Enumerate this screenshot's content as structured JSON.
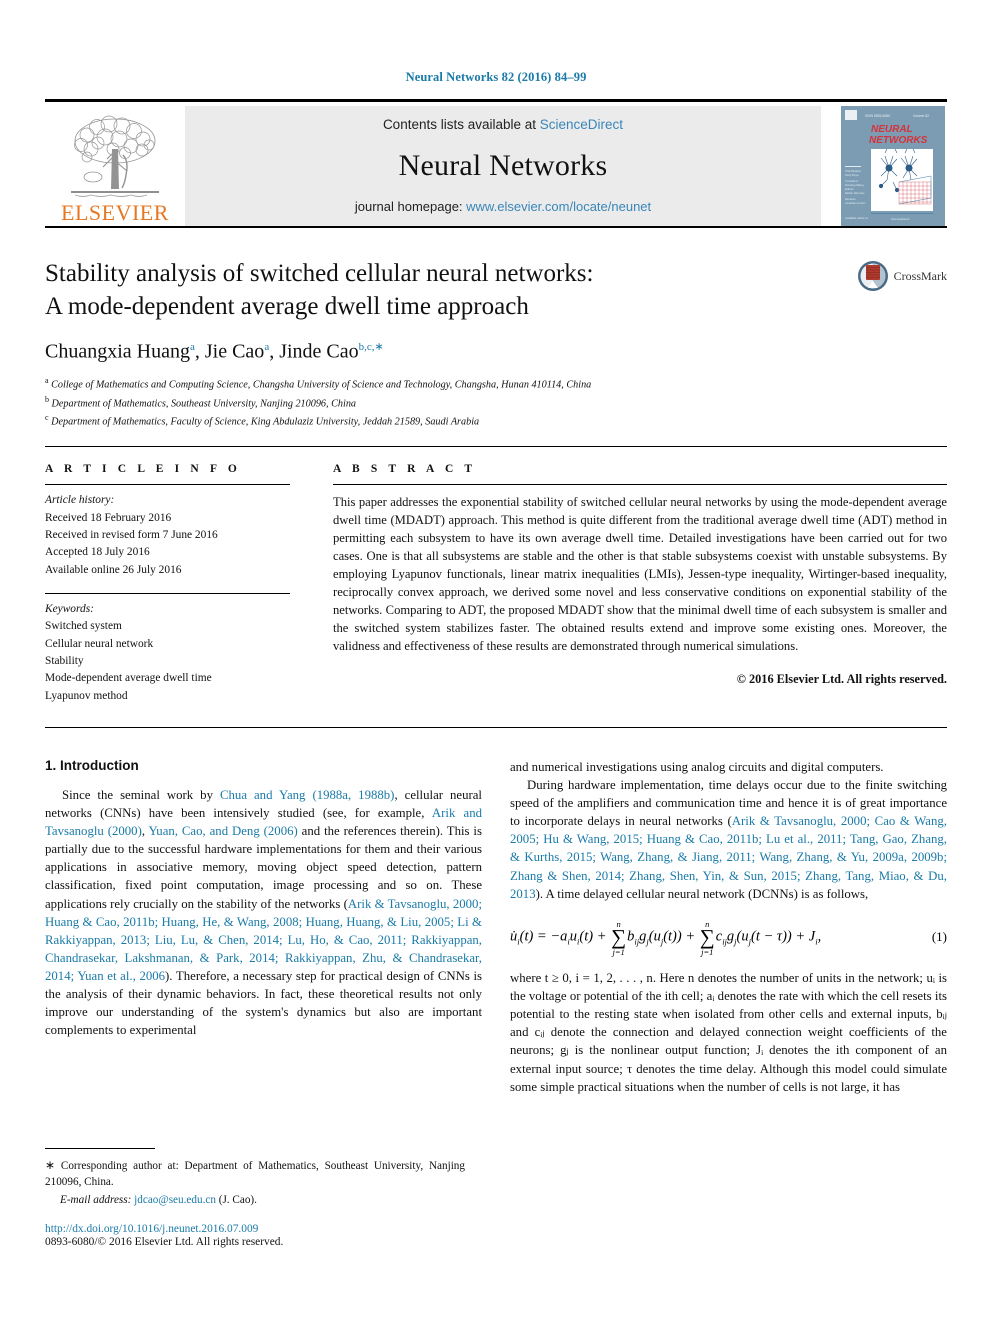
{
  "running_head": "Neural Networks 82 (2016) 84–99",
  "masthead": {
    "contents_prefix": "Contents lists available at ",
    "sciencedirect": "ScienceDirect",
    "journal_name": "Neural Networks",
    "homepage_prefix": "journal homepage: ",
    "homepage_url": "www.elsevier.com/locate/neunet",
    "publisher": "ELSEVIER",
    "cover_title_line1": "NEURAL",
    "cover_title_line2": "NETWORKS"
  },
  "colors": {
    "link_blue": "#1a7aa8",
    "sciencedirect_blue": "#3a86b8",
    "elsevier_orange": "#E87722",
    "masthead_grey": "#ebebeb",
    "cover_blue": "#6f93ad"
  },
  "article": {
    "title_line1": "Stability analysis of switched cellular neural networks:",
    "title_line2": "A mode-dependent average dwell time approach",
    "crossmark_label": "CrossMark",
    "authors": [
      {
        "name": "Chuangxia Huang",
        "sup": "a",
        "sep": ", "
      },
      {
        "name": "Jie Cao",
        "sup": "a",
        "sep": ", "
      },
      {
        "name": "Jinde Cao",
        "sup": "b,c,∗",
        "sep": ""
      }
    ],
    "affiliations": [
      {
        "mark": "a",
        "text": "College of Mathematics and Computing Science, Changsha University of Science and Technology, Changsha, Hunan 410114, China"
      },
      {
        "mark": "b",
        "text": "Department of Mathematics, Southeast University, Nanjing 210096, China"
      },
      {
        "mark": "c",
        "text": "Department of Mathematics, Faculty of Science, King Abdulaziz University, Jeddah 21589, Saudi Arabia"
      }
    ]
  },
  "article_info": {
    "heading": "A R T I C L E    I N F O",
    "history_label": "Article history:",
    "history": [
      "Received 18 February 2016",
      "Received in revised form 7 June 2016",
      "Accepted 18 July 2016",
      "Available online 26 July 2016"
    ],
    "keywords_label": "Keywords:",
    "keywords": [
      "Switched system",
      "Cellular neural network",
      "Stability",
      "Mode-dependent average dwell time",
      "Lyapunov method"
    ]
  },
  "abstract": {
    "heading": "A B S T R A C T",
    "text": "This paper addresses the exponential stability of switched cellular neural networks by using the mode-dependent average dwell time (MDADT) approach. This method is quite different from the traditional average dwell time (ADT) method in permitting each subsystem to have its own average dwell time. Detailed investigations have been carried out for two cases. One is that all subsystems are stable and the other is that stable subsystems coexist with unstable subsystems. By employing Lyapunov functionals, linear matrix inequalities (LMIs), Jessen-type inequality, Wirtinger-based inequality, reciprocally convex approach, we derived some novel and less conservative conditions on exponential stability of the networks. Comparing to ADT, the proposed MDADT show that the minimal dwell time of each subsystem is smaller and the switched system stabilizes faster. The obtained results extend and improve some existing ones. Moreover, the validness and effectiveness of these results are demonstrated through numerical simulations.",
    "copyright": "© 2016 Elsevier Ltd. All rights reserved."
  },
  "body": {
    "section_title": "1. Introduction",
    "left_p1_a": "Since the seminal work by ",
    "left_p1_cite1": "Chua and Yang (1988a, 1988b)",
    "left_p1_b": ", cellular neural networks (CNNs) have been intensively studied (see, for example, ",
    "left_p1_cite2": "Arik and Tavsanoglu (2000)",
    "left_p1_c": ", ",
    "left_p1_cite3": "Yuan, Cao, and Deng (2006)",
    "left_p1_d": " and the references therein). This is partially due to the successful hardware implementations for them and their various applications in associative memory, moving object speed detection, pattern classification, fixed point computation, image processing and so on. These applications rely crucially on the stability of the networks (",
    "left_p1_cite4": "Arik & Tavsanoglu, 2000; Huang & Cao, 2011b; Huang, He, & Wang, 2008; Huang, Huang, & Liu, 2005; Li & Rakkiyappan, 2013; Liu, Lu, & Chen, 2014; Lu, Ho, & Cao, 2011; Rakkiyappan, Chandrasekar, Lakshmanan, & Park, 2014; Rakkiyappan, Zhu, & Chandrasekar, 2014; Yuan et al., 2006",
    "left_p1_e": "). Therefore, a necessary step for practical design of CNNs is the analysis of their dynamic behaviors. In fact, these theoretical results not only improve our understanding of the system's dynamics but also are important complements to experimental",
    "right_p1": "and numerical investigations using analog circuits and digital computers.",
    "right_p2_a": "During hardware implementation, time delays occur due to the finite switching speed of the amplifiers and communication time and hence it is of great importance to incorporate delays in neural networks (",
    "right_p2_cite": "Arik & Tavsanoglu, 2000; Cao & Wang, 2005; Hu & Wang, 2015; Huang & Cao, 2011b; Lu et al., 2011; Tang, Gao, Zhang, & Kurths, 2015; Wang, Zhang, & Jiang, 2011; Wang, Zhang, & Yu, 2009a, 2009b; Zhang & Shen, 2014; Zhang, Shen, Yin, & Sun, 2015; Zhang, Tang, Miao, & Du, 2013",
    "right_p2_b": "). A time delayed cellular neural network (DCNNs) is as follows,",
    "equation": {
      "number": "(1)",
      "lhs": "u̇",
      "lhs_sub": "i",
      "lhs_arg": "(t) = ",
      "term1": "−a",
      "term1_sub": "i",
      "term1_b": "u",
      "term1_sub2": "i",
      "term1_c": "(t) + ",
      "sum_upper": "n",
      "sum_lower": "j=1",
      "term2": "b",
      "term2_sub": "ij",
      "term2_b": "g",
      "term2_sub2": "j",
      "term2_c": "(u",
      "term2_sub3": "j",
      "term2_d": "(t)) + ",
      "term3": "c",
      "term3_sub": "ij",
      "term3_b": "g",
      "term3_sub2": "j",
      "term3_c": "(u",
      "term3_sub3": "j",
      "term3_d": "(t − τ)) + J",
      "term3_sub4": "i",
      "term3_e": ","
    },
    "right_p3": "where t ≥ 0, i = 1, 2, . . . , n. Here n denotes the number of units in the network; uᵢ is the voltage or potential of the ith cell; aᵢ denotes the rate with which the cell resets its potential to the resting state when isolated from other cells and external inputs, bᵢⱼ and cᵢⱼ denote the connection and delayed connection weight coefficients of the neurons; gⱼ is the nonlinear output function; Jᵢ denotes the ith component of an external input source; τ denotes the time delay. Although this model could simulate some simple practical situations when the number of cells is not large, it has"
  },
  "footnote": {
    "star": "∗",
    "corresponding": "Corresponding author at: Department of Mathematics, Southeast University, Nanjing 210096, China.",
    "email_label": "E-mail address:",
    "email": "jdcao@seu.edu.cn",
    "email_suffix": "(J. Cao).",
    "doi": "http://dx.doi.org/10.1016/j.neunet.2016.07.009",
    "issn": "0893-6080/© 2016 Elsevier Ltd. All rights reserved."
  }
}
